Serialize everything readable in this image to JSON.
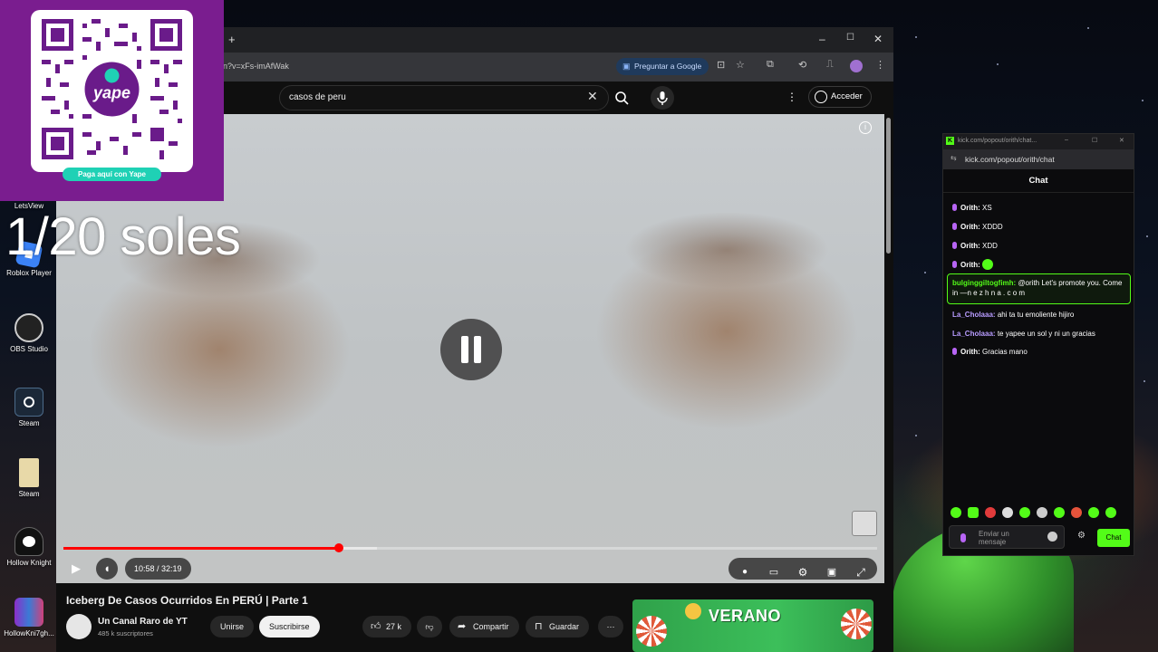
{
  "browser": {
    "url": "n?v=xFs-imAfWak",
    "ask_google": "Preguntar a Google",
    "window_controls": [
      "–",
      "☐",
      "✕"
    ]
  },
  "youtube": {
    "search_value": "casos de peru",
    "signin": "Acceder",
    "player": {
      "time": "10:58 / 32:19",
      "progress": 0.339,
      "buffered": 0.385,
      "paused": false
    },
    "video_title": "Iceberg De Casos Ocurridos En PERÚ | Parte 1",
    "channel_name": "Un Canal Raro de YT",
    "subscribers": "485 k suscriptores",
    "join": "Unirse",
    "subscribe": "Suscribirse",
    "likes": "27 k",
    "share": "Compartir",
    "save": "Guardar",
    "ad_text": "VERANO"
  },
  "overlay": {
    "qr_badge": "Paga aquí con Yape",
    "qr_brand": "yape",
    "donation": "1/20 soles"
  },
  "desktop_icons": [
    {
      "label": "LetsView",
      "icon": "letsview-icon"
    },
    {
      "label": "Roblox Player",
      "icon": "roblox-icon"
    },
    {
      "label": "OBS Studio",
      "icon": "obs-icon"
    },
    {
      "label": "Steam",
      "icon": "steam-icon"
    },
    {
      "label": "Steam",
      "icon": "folder-icon"
    },
    {
      "label": "Hollow Knight",
      "icon": "hollow-knight-icon"
    },
    {
      "label": "HollowKni7gh...",
      "icon": "archive-icon"
    }
  ],
  "chat": {
    "window_title": "kick.com/popout/orith/chat...",
    "url": "kick.com/popout/orith/chat",
    "header": "Chat",
    "messages": [
      {
        "user": "Orith:",
        "text": "XS",
        "user_color": "#ffffff",
        "mic": true
      },
      {
        "user": "Orith:",
        "text": "XDDD",
        "user_color": "#ffffff",
        "mic": true
      },
      {
        "user": "Orith:",
        "text": "XDD",
        "user_color": "#ffffff",
        "mic": true
      },
      {
        "user": "Orith:",
        "text": "",
        "user_color": "#ffffff",
        "mic": true
      },
      {
        "user": "bulginggiltogfimh:",
        "text": "@orith Let's promote you. Come in —n e z h n a . c o m",
        "user_color": "#53fc18",
        "mic": false
      },
      {
        "user": "La_Cholaaa:",
        "text": "ahi ta tu emoliente hijiro",
        "user_color": "#b89cff",
        "mic": false
      },
      {
        "user": "La_Cholaaa:",
        "text": "te yapee un sol y ni un gracias",
        "user_color": "#b89cff",
        "mic": false
      },
      {
        "user": "Orith:",
        "text": "Gracias mano",
        "user_color": "#ffffff",
        "mic": true
      }
    ],
    "input_placeholder": "Enviar un mensaje",
    "send_label": "Chat",
    "accent": "#53fc18"
  }
}
